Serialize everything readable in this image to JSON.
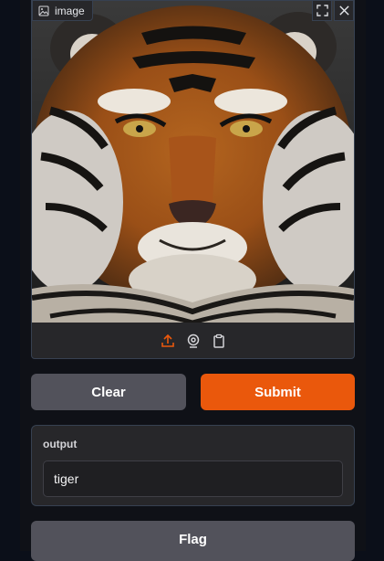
{
  "image_component": {
    "label": "image",
    "label_icon": "image-icon",
    "corner_buttons": [
      "fullscreen-icon",
      "close-icon"
    ],
    "photo_subject": "tiger",
    "source_buttons": [
      "upload-icon",
      "webcam-icon",
      "clipboard-icon"
    ],
    "accent_color": "#ea580c"
  },
  "actions": {
    "clear_label": "Clear",
    "submit_label": "Submit"
  },
  "output": {
    "label": "output",
    "value": "tiger"
  },
  "flag": {
    "label": "Flag"
  },
  "colors": {
    "background": "#0b0f19",
    "panel": "#27272a",
    "secondary_button": "#52525b",
    "primary_button": "#ea580c"
  }
}
